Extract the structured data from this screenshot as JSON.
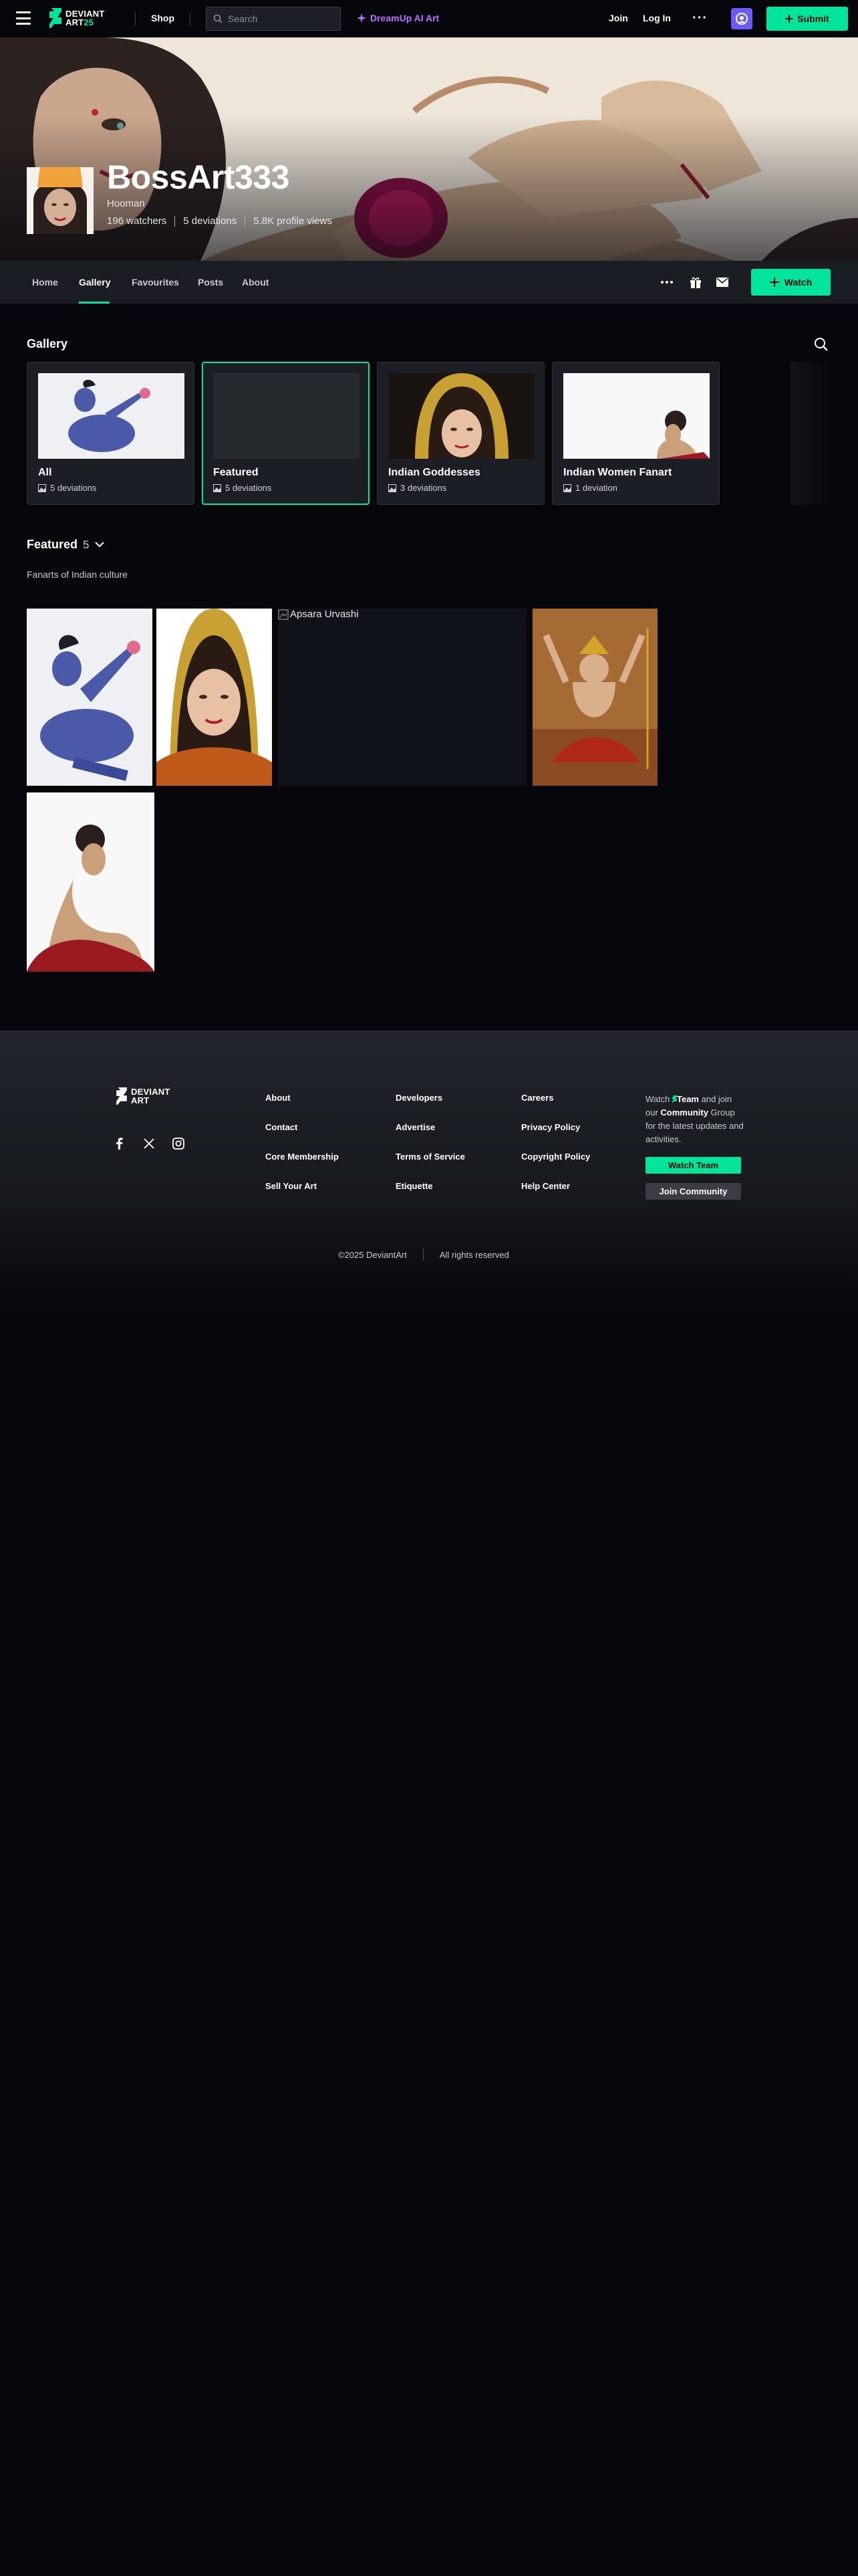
{
  "nav": {
    "logo_line1": "DEVIANT",
    "logo_line2": "ART",
    "logo_badge": "25",
    "shop": "Shop",
    "search_placeholder": "Search",
    "dreamup": "DreamUp AI Art",
    "join": "Join",
    "login": "Log In",
    "more": "···",
    "submit": "Submit"
  },
  "profile": {
    "username": "BossArt333",
    "tagline": "Hooman",
    "watchers": "196 watchers",
    "deviations": "5 deviations",
    "views": "5.8K profile views"
  },
  "tabs": {
    "home": "Home",
    "gallery": "Gallery",
    "favourites": "Favourites",
    "posts": "Posts",
    "about": "About",
    "watch": "Watch"
  },
  "gallery": {
    "title": "Gallery",
    "folders": [
      {
        "name": "All",
        "count": "5 deviations"
      },
      {
        "name": "Featured",
        "count": "5 deviations"
      },
      {
        "name": "Indian Goddesses",
        "count": "3 deviations"
      },
      {
        "name": "Indian Women Fanart",
        "count": "1 deviation"
      }
    ]
  },
  "featured": {
    "title": "Featured",
    "count": "5",
    "description": "Fanarts of Indian culture",
    "broken_alt": "Apsara Urvashi"
  },
  "footer": {
    "logo_line1": "DEVIANT",
    "logo_line2": "ART",
    "col1": [
      "About",
      "Contact",
      "Core Membership",
      "Sell Your Art"
    ],
    "col2": [
      "Developers",
      "Advertise",
      "Terms of Service",
      "Etiquette"
    ],
    "col3": [
      "Careers",
      "Privacy Policy",
      "Copyright Policy",
      "Help Center"
    ],
    "watch_pre": "Watch",
    "watch_team": "Team",
    "watch_mid": "and join our",
    "watch_community": "Community",
    "watch_post": "Group for the latest updates and activities.",
    "watch_team_btn": "Watch Team",
    "join_community_btn": "Join Community",
    "copyright": "©2025 DeviantArt",
    "rights": "All rights reserved"
  },
  "colors": {
    "accent": "#00e59b",
    "dreamup": "#c06cff",
    "background": "#06070d",
    "panel": "#1b1e25"
  },
  "icons": [
    "menu-icon",
    "search-icon",
    "sparkle-icon",
    "ellipsis-icon",
    "plus-icon",
    "gift-icon",
    "mail-icon",
    "image-icon",
    "chevron-down-icon",
    "facebook-icon",
    "x-icon",
    "instagram-icon"
  ]
}
